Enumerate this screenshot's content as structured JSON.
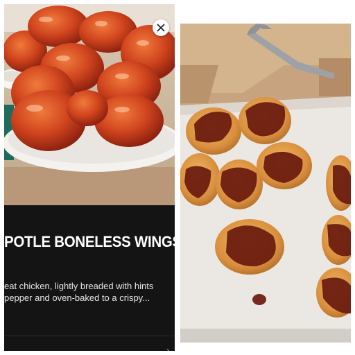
{
  "left_panel": {
    "title": "POTLE BONELESS WINGS",
    "description_lines": [
      "eat chicken, lightly breaded with hints",
      "pepper and oven-baked to a crispy..."
    ],
    "icons": {
      "close": "close-icon",
      "chevron": "chevron-right-icon"
    },
    "colors": {
      "background": "#141414",
      "title": "#ffffff",
      "sauce": "#b8341a"
    }
  },
  "right_panel": {
    "icons": {
      "fork": "fork-icon"
    },
    "colors": {
      "cardboard": "#c7a47f",
      "parchment": "#ebe7e2",
      "nugget": "#dc9a4a",
      "sauce": "#6a1a0e"
    }
  }
}
